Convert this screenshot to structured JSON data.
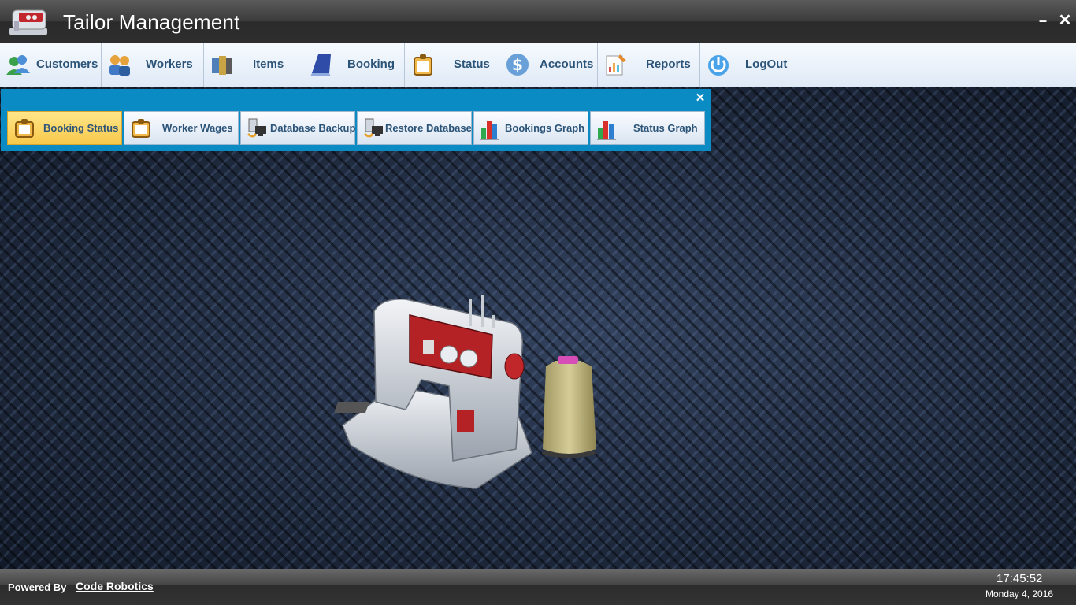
{
  "window": {
    "title": "Tailor Management",
    "minimize_label": "–",
    "close_label": "✕"
  },
  "menu": {
    "items": [
      {
        "label": "Customers",
        "icon": "customers-icon"
      },
      {
        "label": "Workers",
        "icon": "workers-icon"
      },
      {
        "label": "Items",
        "icon": "items-icon"
      },
      {
        "label": "Booking",
        "icon": "booking-icon"
      },
      {
        "label": "Status",
        "icon": "status-icon"
      },
      {
        "label": "Accounts",
        "icon": "accounts-icon"
      },
      {
        "label": "Reports",
        "icon": "reports-icon"
      },
      {
        "label": "LogOut",
        "icon": "logout-icon"
      }
    ]
  },
  "submenu": {
    "close_label": "✕",
    "active_item": "Booking Status",
    "items": [
      {
        "label": "Booking Status",
        "icon": "clipboard-icon"
      },
      {
        "label": "Worker Wages",
        "icon": "clipboard-icon"
      },
      {
        "label": "Database Backup",
        "icon": "database-backup-icon"
      },
      {
        "label": "Restore Database",
        "icon": "database-restore-icon"
      },
      {
        "label": "Bookings Graph",
        "icon": "bar-chart-icon"
      },
      {
        "label": "Status Graph",
        "icon": "bar-chart-icon"
      }
    ]
  },
  "statusbar": {
    "powered_by": "Powered By",
    "company": "Code Robotics",
    "time": "17:45:52",
    "date": "Monday 4, 2016"
  },
  "colors": {
    "menu_text": "#2c5478",
    "submenu_panel": "#0a8bc4",
    "active_button": "#f8c84a"
  }
}
